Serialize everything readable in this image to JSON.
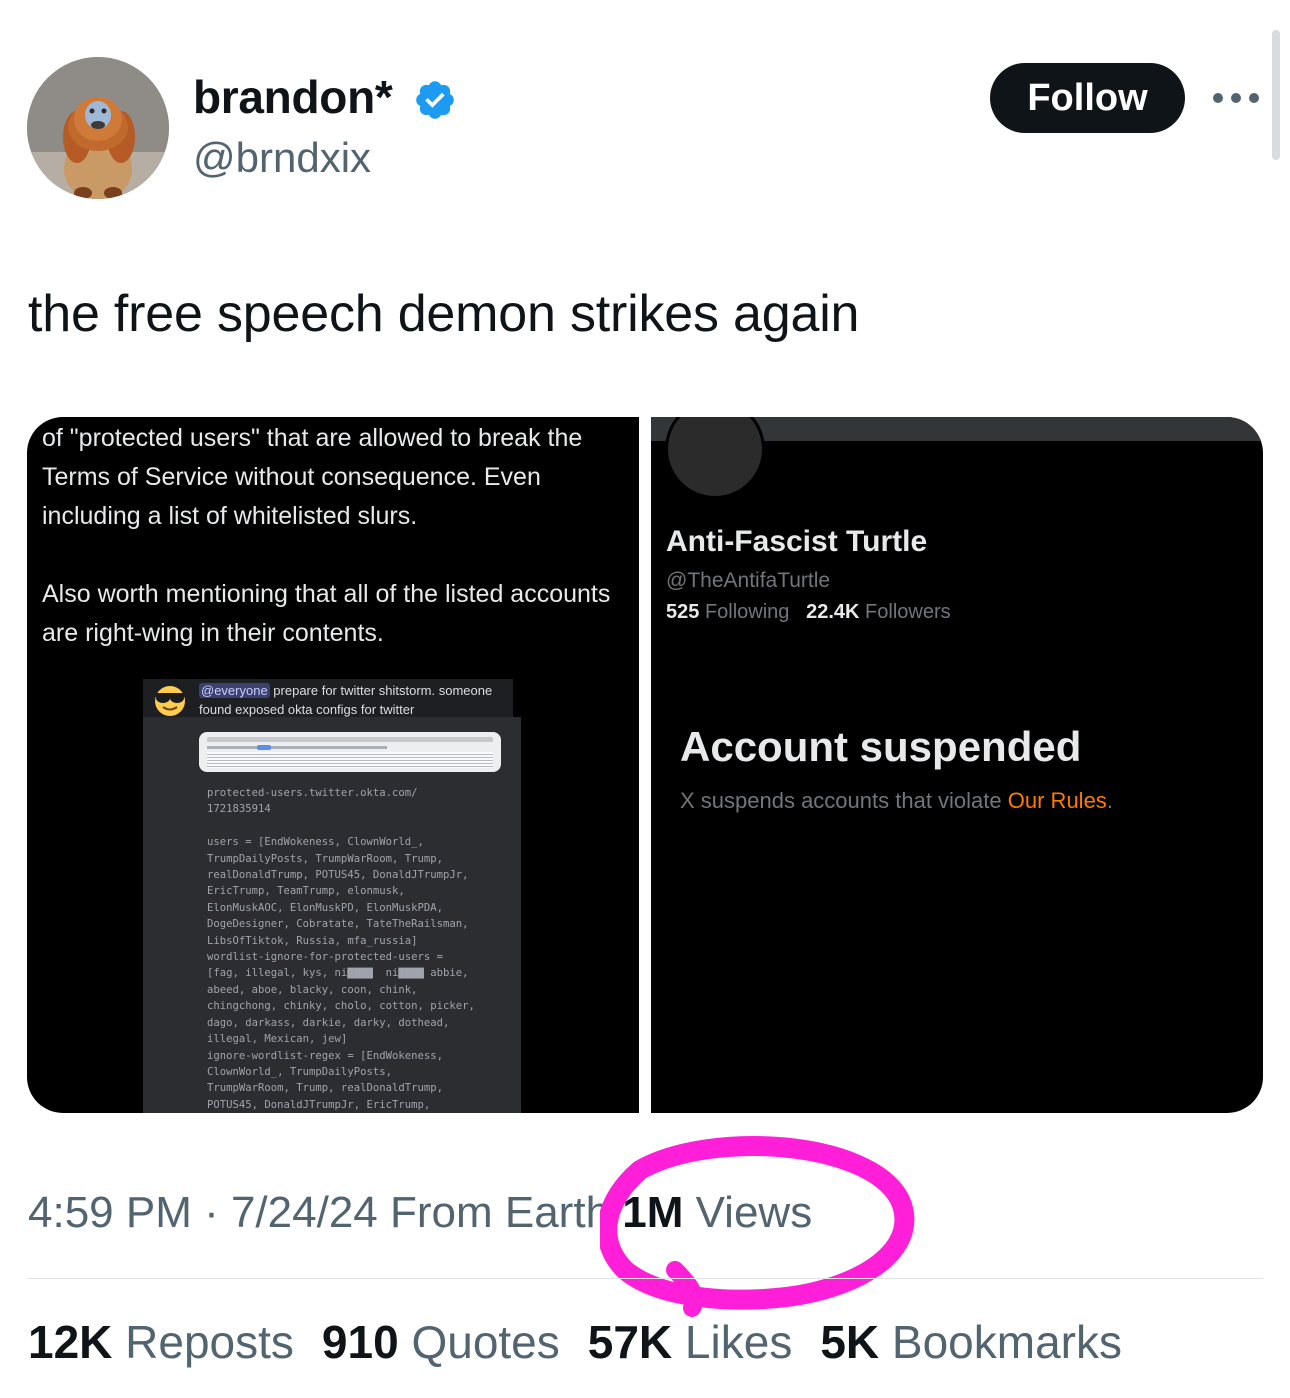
{
  "author": {
    "display_name": "brandon*",
    "handle": "@brndxix",
    "verified": true,
    "verified_color": "#1d9bf0"
  },
  "actions": {
    "follow_label": "Follow",
    "more_icon": "more-horizontal-icon"
  },
  "tweet": {
    "text": "the free speech demon strikes again"
  },
  "media_left": {
    "paragraph1": "of \"protected users\" that are allowed to break the Terms of Service without consequence. Even including a list of whitelisted slurs.",
    "paragraph2": "Also worth mentioning that all of the listed accounts are right-wing in their contents.",
    "discord": {
      "mention": "@everyone",
      "line1_rest": " prepare for twitter shitstorm. someone",
      "line2": "found exposed okta configs for twitter"
    },
    "code_text": "protected-users.twitter.okta.com/\n1721835914\n\nusers = [EndWokeness, ClownWorld_,\nTrumpDailyPosts, TrumpWarRoom, Trump,\nrealDonaldTrump, POTUS45, DonaldJTrumpJr,\nEricTrump, TeamTrump, elonmusk,\nElonMuskAOC, ElonMuskPD, ElonMuskPDA,\nDogeDesigner, Cobratate, TateTheRailsman,\nLibsOfTiktok, Russia, mfa_russia]\nwordlist-ignore-for-protected-users =\n[fag, illegal, kys, ni▇▇▇▇  ni▇▇▇▇ abbie,\nabeed, aboe, blacky, coon, chink,\nchingchong, chinky, cholo, cotton, picker,\ndago, darkass, darkie, darky, dothead,\nillegal, Mexican, jew]\nignore-wordlist-regex = [EndWokeness,\nClownWorld_, TrumpDailyPosts,\nTrumpWarRoom, Trump, realDonaldTrump,\nPOTUS45, DonaldJTrumpJr, EricTrump,"
  },
  "media_right": {
    "name": "Anti-Fascist Turtle",
    "handle": "@TheAntifaTurtle",
    "following_count": "525",
    "following_label": "Following",
    "followers_count": "22.4K",
    "followers_label": "Followers",
    "suspended_title": "Account suspended",
    "suspended_desc": "X suspends accounts that violate ",
    "rules_link": "Our Rules",
    "rules_end": ".",
    "rules_color": "#ff7a00"
  },
  "meta": {
    "timestamp": "4:59 PM · 7/24/24 From Earth ",
    "views_count": "1M",
    "views_label": " Views",
    "annotation_color": "#ff1fd8"
  },
  "stats": {
    "reposts_count": "12K",
    "reposts_label": " Reposts",
    "quotes_count": "910",
    "quotes_label": " Quotes",
    "likes_count": "57K",
    "likes_label": " Likes",
    "bookmarks_count": "5K",
    "bookmarks_label": " Bookmarks"
  }
}
